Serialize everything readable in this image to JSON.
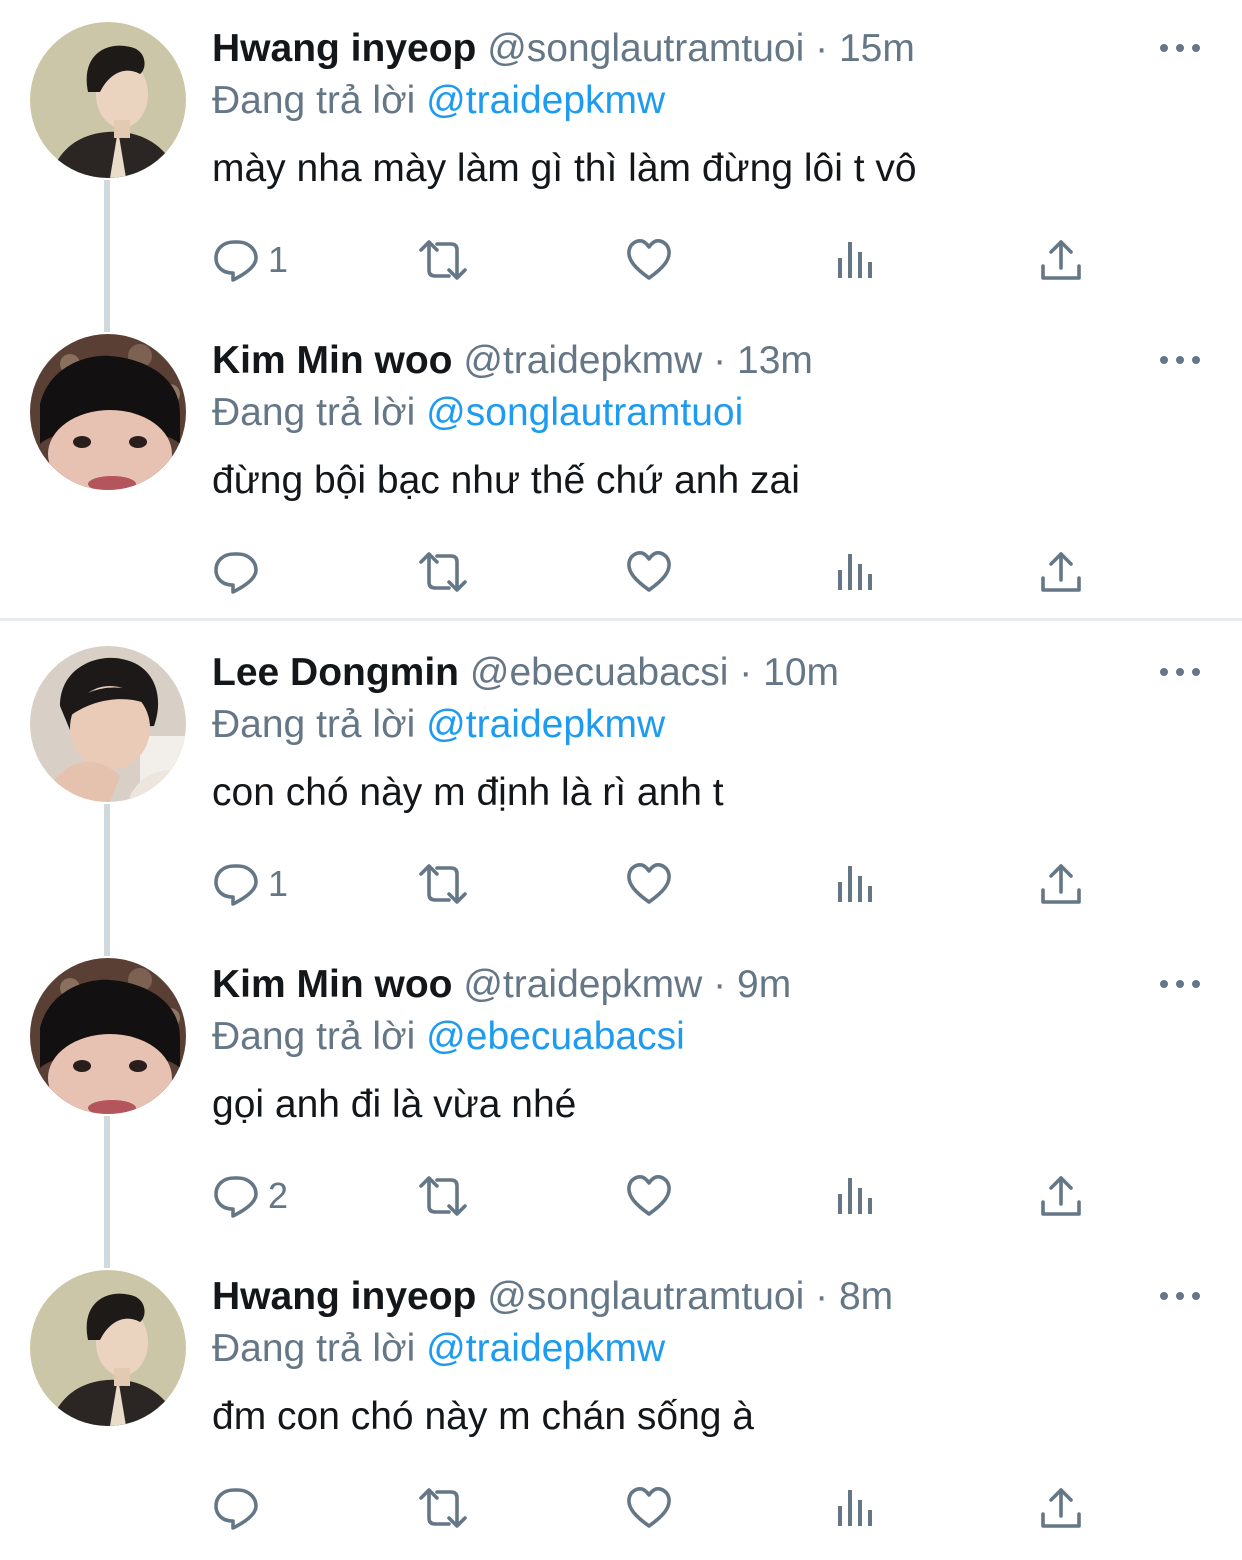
{
  "tweets": [
    {
      "name": "Hwang inyeop",
      "handle": "@songlautramtuoi",
      "separator": "·",
      "time": "15m",
      "reply_label": "Đang trả lời",
      "reply_to": "@traidepkmw",
      "text": "mày nha mày làm gì thì làm đừng lôi t vô",
      "reply_count": "1"
    },
    {
      "name": "Kim Min woo",
      "handle": "@traidepkmw",
      "separator": "·",
      "time": "13m",
      "reply_label": "Đang trả lời",
      "reply_to": "@songlautramtuoi",
      "text": "đừng bội bạc như thế chứ anh zai",
      "reply_count": ""
    },
    {
      "name": "Lee Dongmin",
      "handle": "@ebecuabacsi",
      "separator": "·",
      "time": "10m",
      "reply_label": "Đang trả lời",
      "reply_to": "@traidepkmw",
      "text": "con chó này m định là rì anh t",
      "reply_count": "1"
    },
    {
      "name": "Kim Min woo",
      "handle": "@traidepkmw",
      "separator": "·",
      "time": "9m",
      "reply_label": "Đang trả lời",
      "reply_to": "@ebecuabacsi",
      "text": "gọi anh đi là vừa nhé",
      "reply_count": "2"
    },
    {
      "name": "Hwang inyeop",
      "handle": "@songlautramtuoi",
      "separator": "·",
      "time": "8m",
      "reply_label": "Đang trả lời",
      "reply_to": "@traidepkmw",
      "text": "đm con chó này m chán sống à",
      "reply_count": ""
    }
  ],
  "colors": {
    "text": "#14171a",
    "muted": "#657786",
    "link": "#1d9bf0",
    "thread_line": "#cfd9de",
    "divider": "#e6ecf0"
  },
  "icons": {
    "reply": "reply-bubble-icon",
    "retweet": "retweet-icon",
    "like": "heart-icon",
    "analytics": "analytics-bars-icon",
    "share": "share-upload-icon",
    "more": "more-dots-icon"
  }
}
